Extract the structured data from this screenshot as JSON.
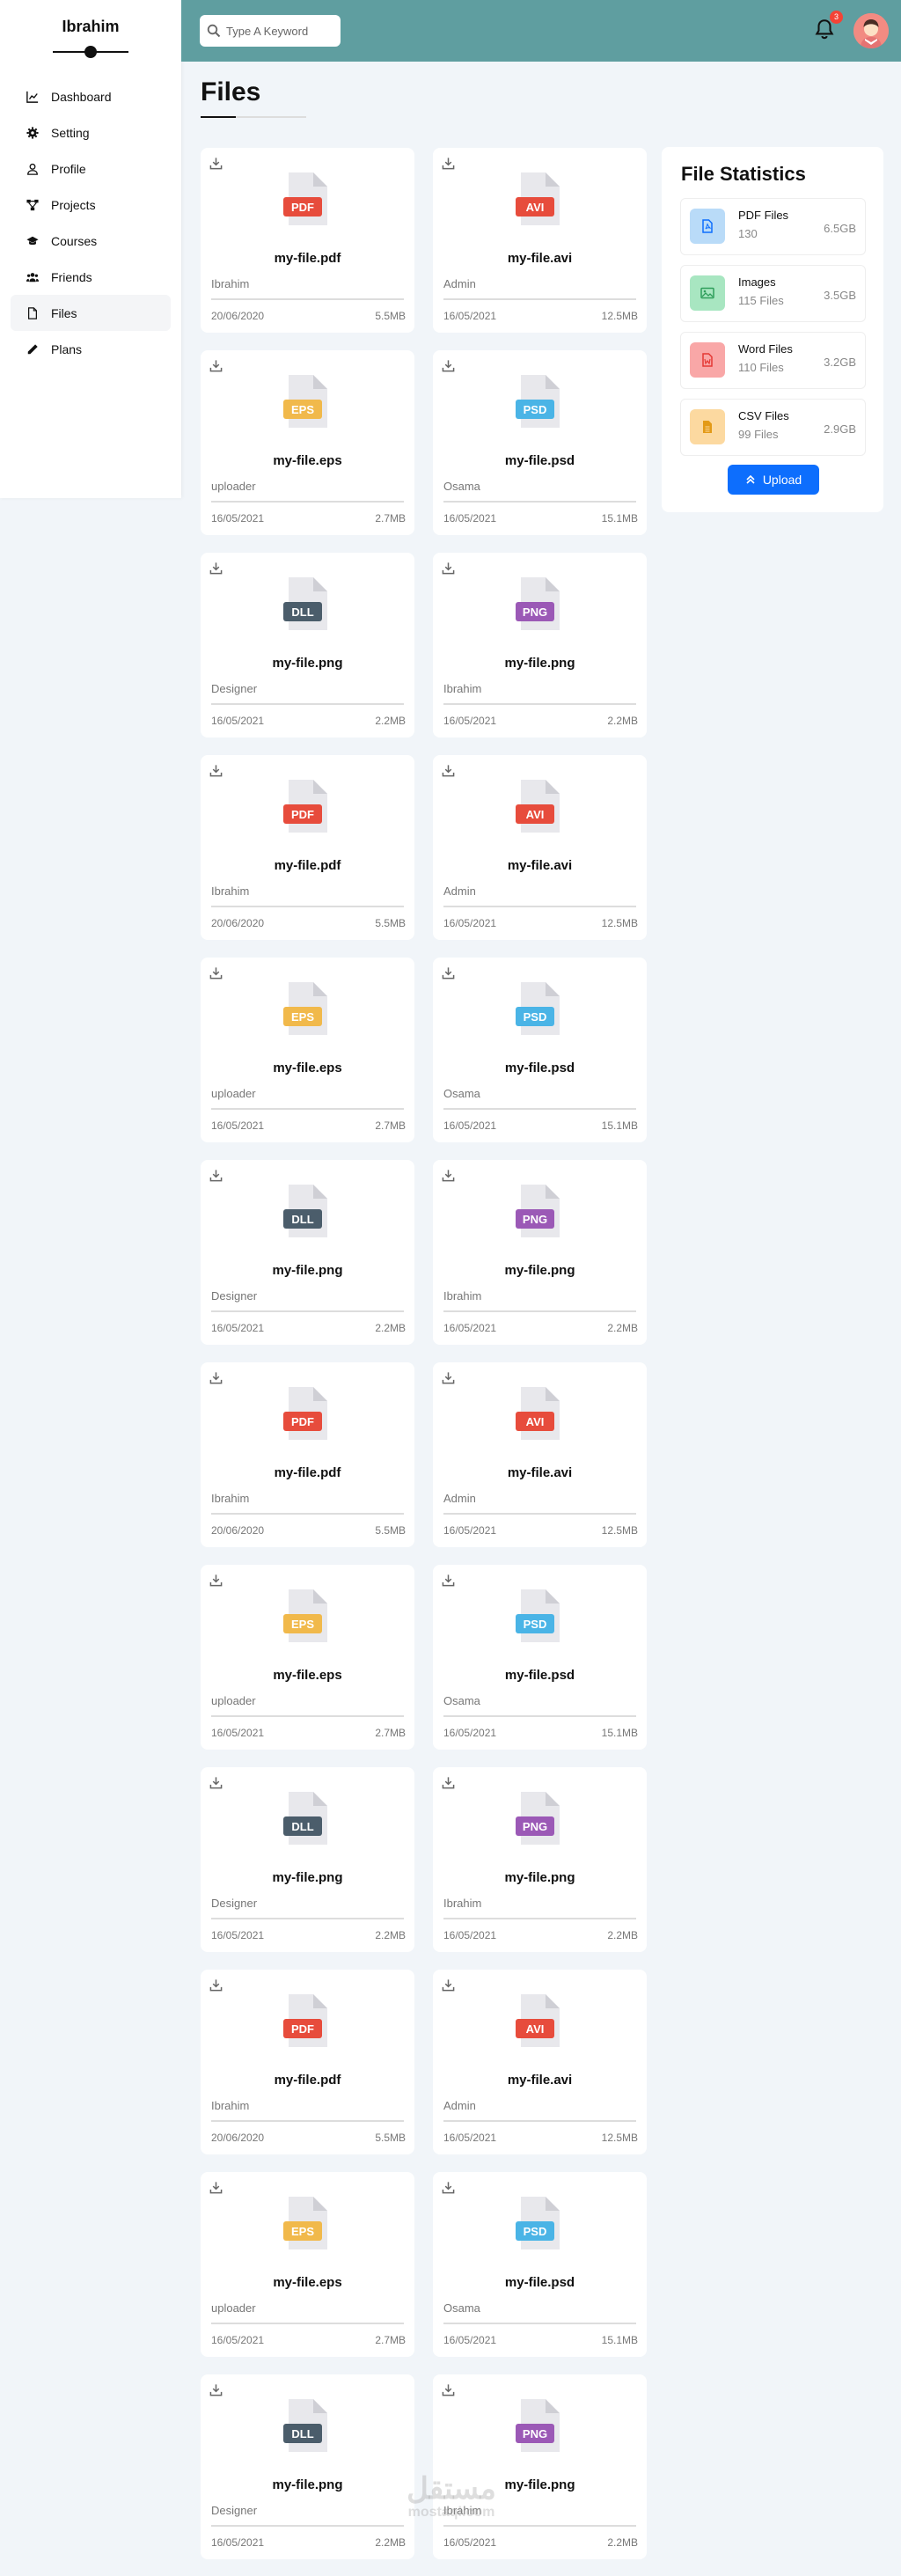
{
  "sidebar": {
    "brand": "Ibrahim",
    "items": [
      {
        "label": "Dashboard",
        "icon": "chart-line-icon"
      },
      {
        "label": "Setting",
        "icon": "gear-icon"
      },
      {
        "label": "Profile",
        "icon": "user-icon"
      },
      {
        "label": "Projects",
        "icon": "diagram-icon"
      },
      {
        "label": "Courses",
        "icon": "graduation-cap-icon"
      },
      {
        "label": "Friends",
        "icon": "users-icon"
      },
      {
        "label": "Files",
        "icon": "file-icon",
        "active": true
      },
      {
        "label": "Plans",
        "icon": "pencil-icon"
      }
    ]
  },
  "header": {
    "search_placeholder": "Type A Keyword",
    "notifications": "3"
  },
  "page": {
    "title": "Files"
  },
  "colors": {
    "header": "#5f9ea0",
    "accent": "#0d6efd",
    "pdf": "#e74c3c",
    "avi": "#e74c3c",
    "eps": "#f1b94b",
    "psd": "#4ab4e6",
    "dll": "#4b5d6b",
    "png": "#9b59b6"
  },
  "files": [
    {
      "tag": "PDF",
      "name": "my-file.pdf",
      "owner": "Ibrahim",
      "date": "20/06/2020",
      "size": "5.5MB"
    },
    {
      "tag": "AVI",
      "name": "my-file.avi",
      "owner": "Admin",
      "date": "16/05/2021",
      "size": "12.5MB"
    },
    {
      "tag": "EPS",
      "name": "my-file.eps",
      "owner": "uploader",
      "date": "16/05/2021",
      "size": "2.7MB"
    },
    {
      "tag": "PSD",
      "name": "my-file.psd",
      "owner": "Osama",
      "date": "16/05/2021",
      "size": "15.1MB"
    },
    {
      "tag": "DLL",
      "name": "my-file.png",
      "owner": "Designer",
      "date": "16/05/2021",
      "size": "2.2MB"
    },
    {
      "tag": "PNG",
      "name": "my-file.png",
      "owner": "Ibrahim",
      "date": "16/05/2021",
      "size": "2.2MB"
    },
    {
      "tag": "PDF",
      "name": "my-file.pdf",
      "owner": "Ibrahim",
      "date": "20/06/2020",
      "size": "5.5MB"
    },
    {
      "tag": "AVI",
      "name": "my-file.avi",
      "owner": "Admin",
      "date": "16/05/2021",
      "size": "12.5MB"
    },
    {
      "tag": "EPS",
      "name": "my-file.eps",
      "owner": "uploader",
      "date": "16/05/2021",
      "size": "2.7MB"
    },
    {
      "tag": "PSD",
      "name": "my-file.psd",
      "owner": "Osama",
      "date": "16/05/2021",
      "size": "15.1MB"
    },
    {
      "tag": "DLL",
      "name": "my-file.png",
      "owner": "Designer",
      "date": "16/05/2021",
      "size": "2.2MB"
    },
    {
      "tag": "PNG",
      "name": "my-file.png",
      "owner": "Ibrahim",
      "date": "16/05/2021",
      "size": "2.2MB"
    },
    {
      "tag": "PDF",
      "name": "my-file.pdf",
      "owner": "Ibrahim",
      "date": "20/06/2020",
      "size": "5.5MB"
    },
    {
      "tag": "AVI",
      "name": "my-file.avi",
      "owner": "Admin",
      "date": "16/05/2021",
      "size": "12.5MB"
    },
    {
      "tag": "EPS",
      "name": "my-file.eps",
      "owner": "uploader",
      "date": "16/05/2021",
      "size": "2.7MB"
    },
    {
      "tag": "PSD",
      "name": "my-file.psd",
      "owner": "Osama",
      "date": "16/05/2021",
      "size": "15.1MB"
    },
    {
      "tag": "DLL",
      "name": "my-file.png",
      "owner": "Designer",
      "date": "16/05/2021",
      "size": "2.2MB"
    },
    {
      "tag": "PNG",
      "name": "my-file.png",
      "owner": "Ibrahim",
      "date": "16/05/2021",
      "size": "2.2MB"
    },
    {
      "tag": "PDF",
      "name": "my-file.pdf",
      "owner": "Ibrahim",
      "date": "20/06/2020",
      "size": "5.5MB"
    },
    {
      "tag": "AVI",
      "name": "my-file.avi",
      "owner": "Admin",
      "date": "16/05/2021",
      "size": "12.5MB"
    },
    {
      "tag": "EPS",
      "name": "my-file.eps",
      "owner": "uploader",
      "date": "16/05/2021",
      "size": "2.7MB"
    },
    {
      "tag": "PSD",
      "name": "my-file.psd",
      "owner": "Osama",
      "date": "16/05/2021",
      "size": "15.1MB"
    },
    {
      "tag": "DLL",
      "name": "my-file.png",
      "owner": "Designer",
      "date": "16/05/2021",
      "size": "2.2MB"
    },
    {
      "tag": "PNG",
      "name": "my-file.png",
      "owner": "Ibrahim",
      "date": "16/05/2021",
      "size": "2.2MB"
    }
  ],
  "stats": {
    "title": "File Statistics",
    "items": [
      {
        "name": "PDF Files",
        "count": "130",
        "size": "6.5GB",
        "icon": "file-pdf-icon",
        "color": "#0d6efd",
        "bg": "#b9dbf8"
      },
      {
        "name": "Images",
        "count": "115 Files",
        "size": "3.5GB",
        "icon": "image-icon",
        "color": "#2e9e5b",
        "bg": "#a8e6c1"
      },
      {
        "name": "Word Files",
        "count": "110 Files",
        "size": "3.2GB",
        "icon": "file-word-icon",
        "color": "#e53935",
        "bg": "#f9a7a7"
      },
      {
        "name": "CSV Files",
        "count": "99 Files",
        "size": "2.9GB",
        "icon": "file-csv-icon",
        "color": "#e39a17",
        "bg": "#fcd9a0"
      }
    ],
    "upload_label": "Upload"
  },
  "watermark": {
    "main": "مستقل",
    "sub": "mostaql.com"
  }
}
